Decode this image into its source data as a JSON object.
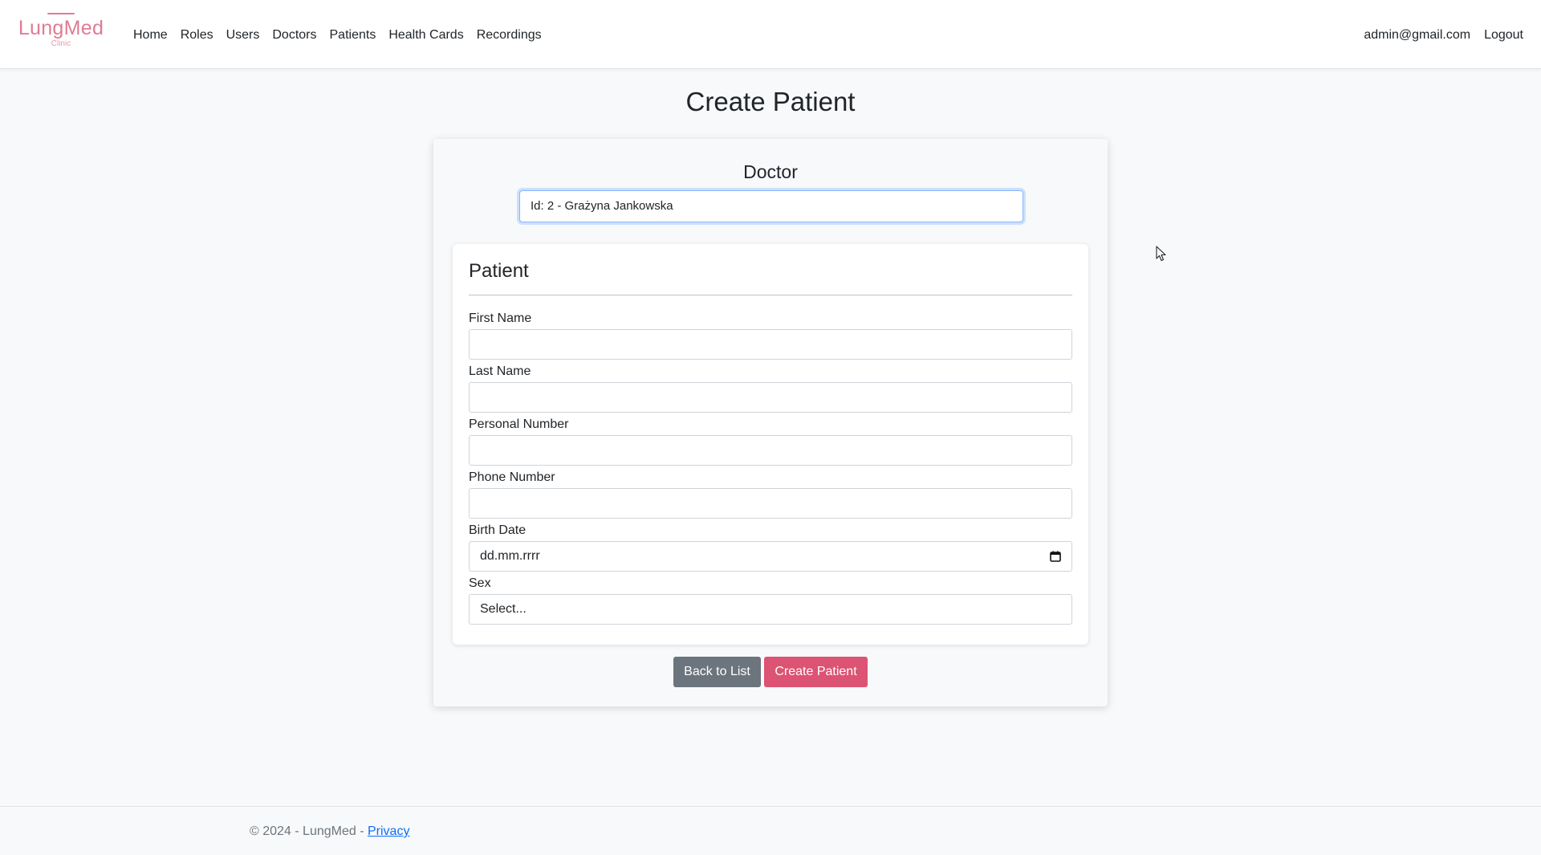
{
  "nav": {
    "brand_name": "LungMed",
    "brand_sub": "Clinic",
    "links": [
      "Home",
      "Roles",
      "Users",
      "Doctors",
      "Patients",
      "Health Cards",
      "Recordings"
    ],
    "user_email": "admin@gmail.com",
    "logout": "Logout"
  },
  "page": {
    "title": "Create Patient"
  },
  "doctor": {
    "label": "Doctor",
    "selected": "Id: 2 - Grażyna Jankowska"
  },
  "patient": {
    "title": "Patient",
    "first_name_label": "First Name",
    "first_name_value": "",
    "last_name_label": "Last Name",
    "last_name_value": "",
    "personal_number_label": "Personal Number",
    "personal_number_value": "",
    "phone_number_label": "Phone Number",
    "phone_number_value": "",
    "birth_date_label": "Birth Date",
    "birth_date_placeholder": "dd.mm.rrrr",
    "sex_label": "Sex",
    "sex_selected": "Select..."
  },
  "buttons": {
    "back": "Back to List",
    "create": "Create Patient"
  },
  "footer": {
    "text": "© 2024 - LungMed - ",
    "privacy": "Privacy"
  },
  "colors": {
    "brand": "#e07b93",
    "create_button": "#dc5373",
    "back_button": "#6c757d",
    "link": "#0d6efd"
  }
}
